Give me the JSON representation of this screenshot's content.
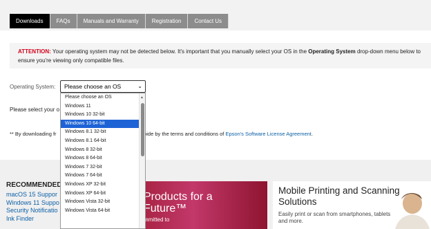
{
  "tabs": [
    {
      "label": "Downloads"
    },
    {
      "label": "FAQs"
    },
    {
      "label": "Manuals and Warranty"
    },
    {
      "label": "Registration"
    },
    {
      "label": "Contact Us"
    }
  ],
  "attention": {
    "label": "ATTENTION:",
    "text_a": " Your operating system may not be detected below. It's important that you manually select your OS in the ",
    "emph": "Operating System",
    "text_b": " drop-down menu below to ensure you're viewing only compatible files."
  },
  "os": {
    "label": "Operating System:",
    "selected": "Please choose an OS",
    "options": [
      "Please choose an OS",
      "Windows 11",
      "Windows 10 32-bit",
      "Windows 10 64-bit",
      "Windows 8.1 32-bit",
      "Windows 8.1 64-bit",
      "Windows 8 32-bit",
      "Windows 8 64-bit",
      "Windows 7 32-bit",
      "Windows 7 64-bit",
      "Windows XP 32-bit",
      "Windows XP 64-bit",
      "Windows Vista 32-bit",
      "Windows Vista 64-bit"
    ],
    "highlighted": "Windows 10 64-bit"
  },
  "please_line": "Please select your o",
  "note": {
    "prefix": "** By downloading fr",
    "middle": "to abide by the terms and conditions of ",
    "link": "Epson's Software License Agreement",
    "suffix": "."
  },
  "recommended": {
    "heading": "RECOMMENDED",
    "links": [
      "macOS 15 Suppor",
      "Windows 11 Suppo",
      "Security Notificatio",
      "Ink Finder"
    ]
  },
  "promo1": {
    "line1": "Products for a",
    "line2": "Future™",
    "line3": "mmitted to"
  },
  "promo2": {
    "title_1": "Mobile Printing and Scanning",
    "title_2": "Solutions",
    "sub_1": "Easily print or scan from smartphones, tablets",
    "sub_2": "and more."
  },
  "colors": {
    "active_tab": "#000000",
    "tab": "#8c8c8c",
    "attention": "#d0021b",
    "link": "#0b5fa5",
    "selection": "#1e63d6"
  }
}
